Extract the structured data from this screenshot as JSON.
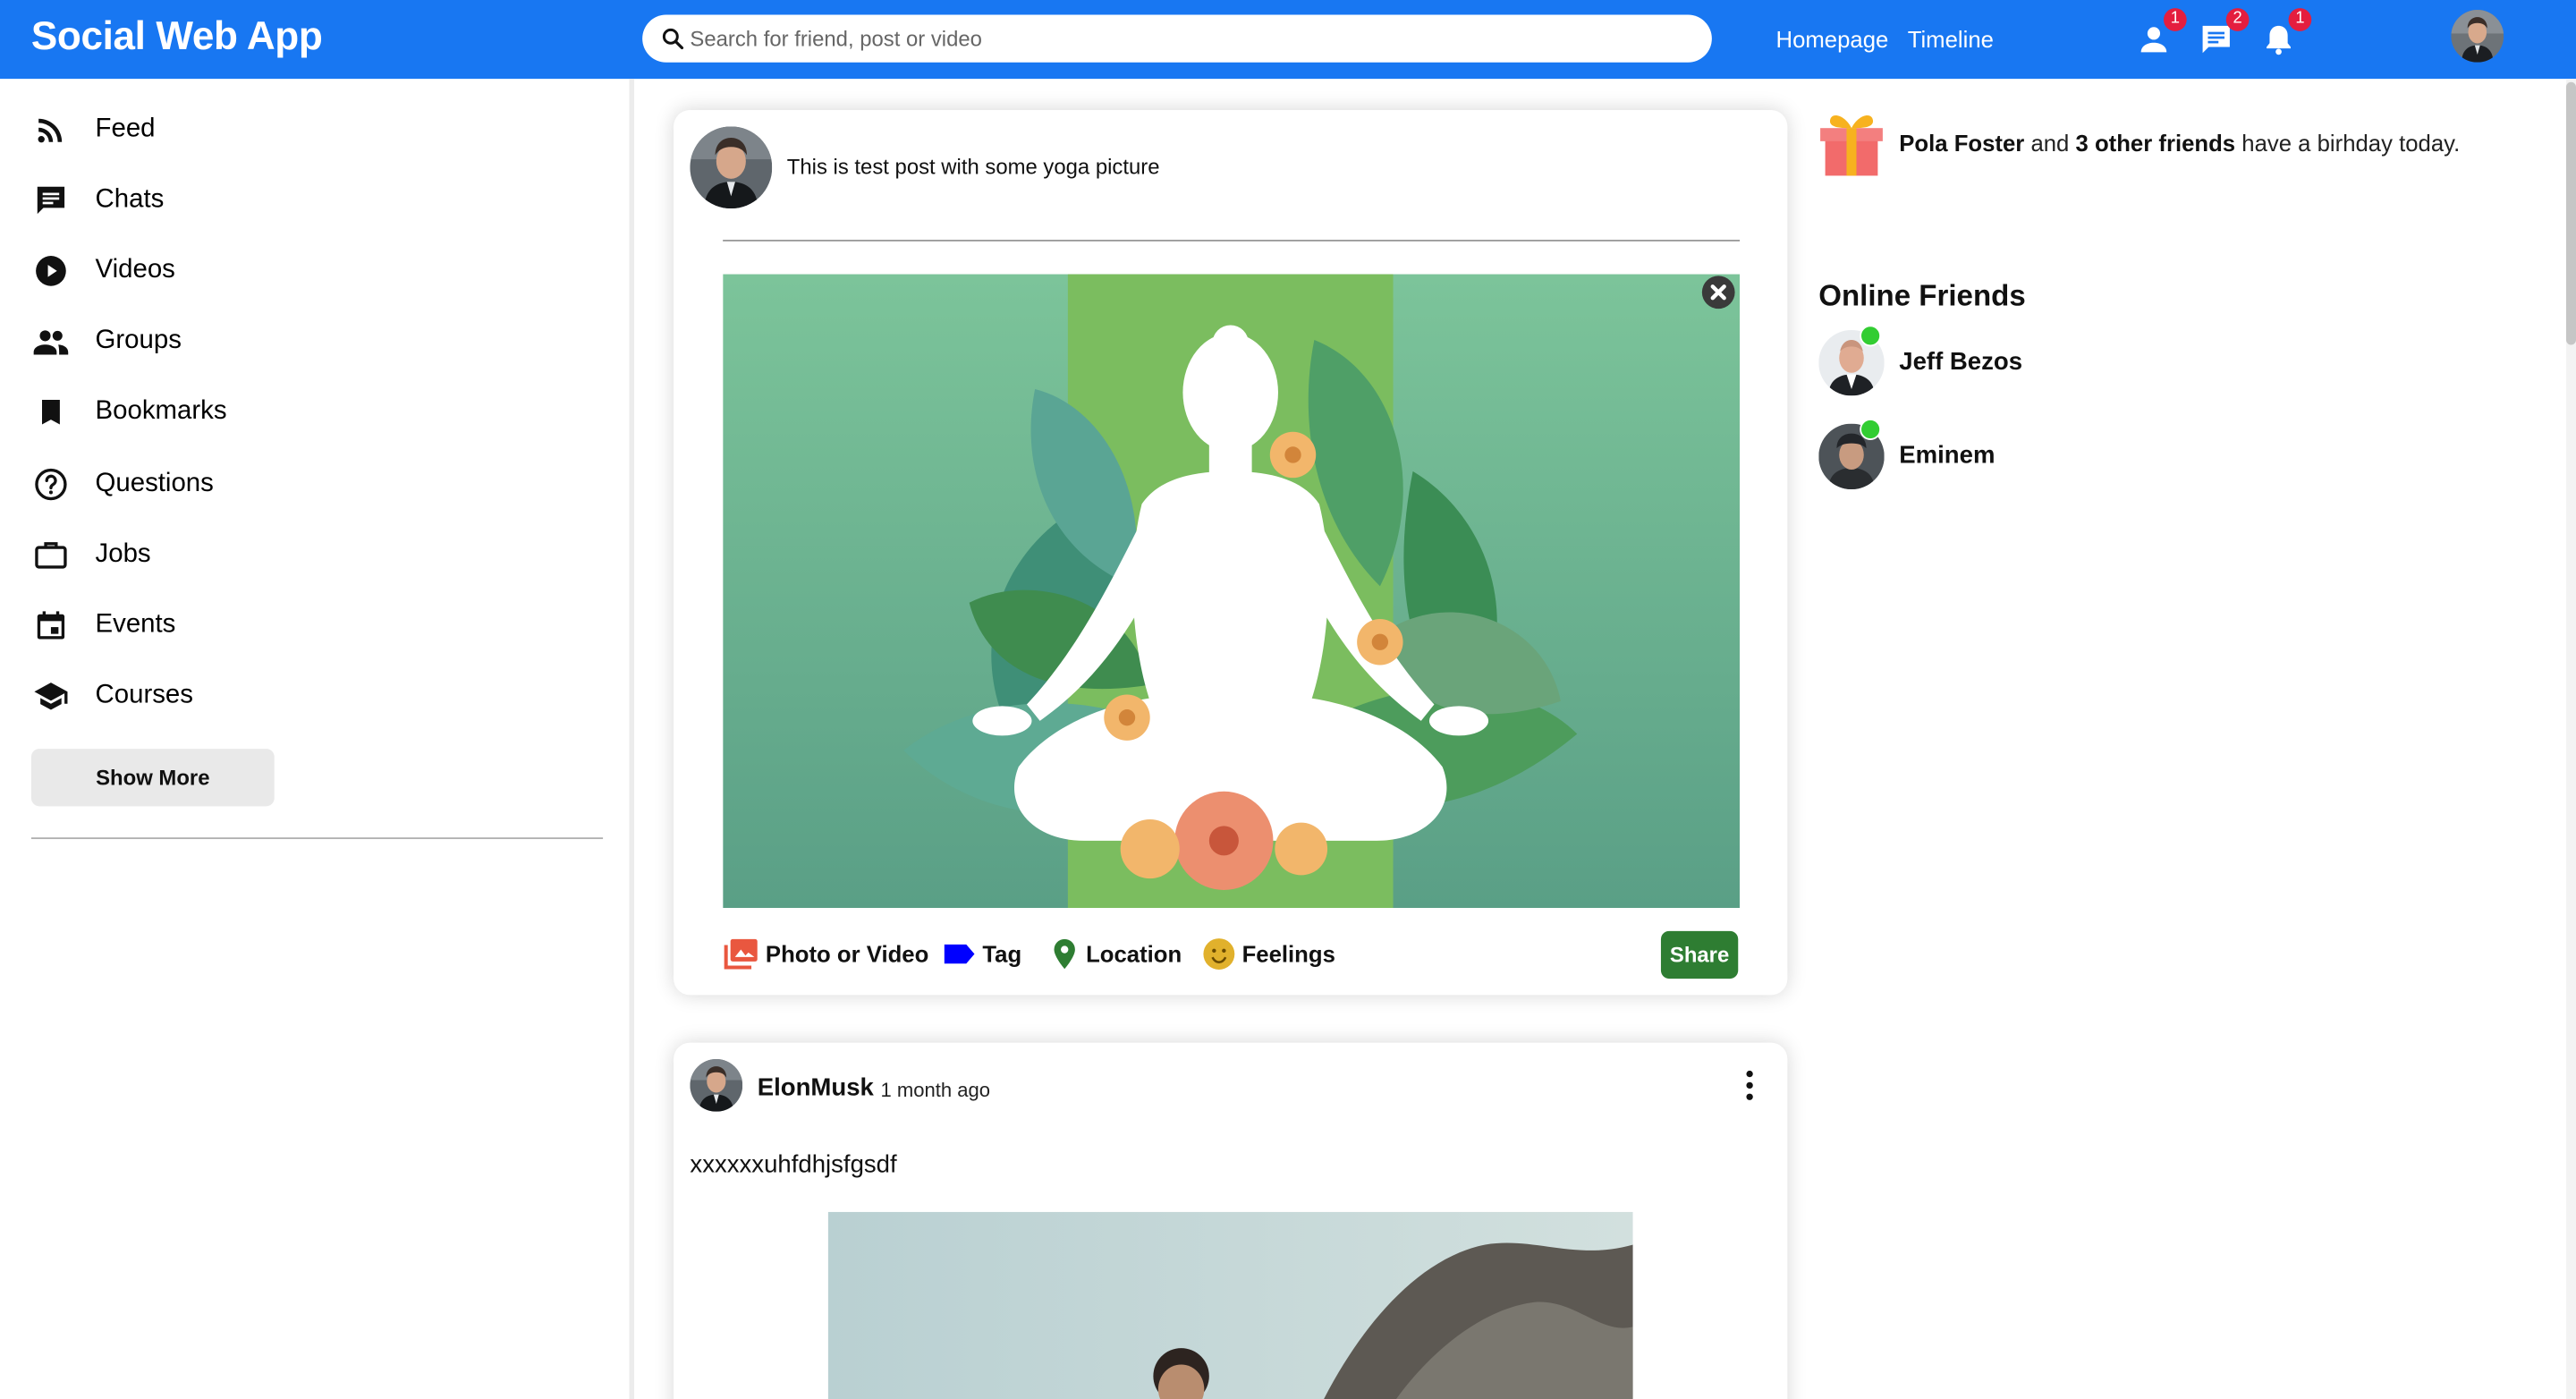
{
  "app": {
    "title": "Social Web App"
  },
  "search": {
    "placeholder": "Search for friend, post or video"
  },
  "nav": {
    "links": [
      "Homepage",
      "Timeline"
    ]
  },
  "notifications": {
    "friend_requests": "1",
    "messages": "2",
    "alerts": "1"
  },
  "sidebar": {
    "items": [
      {
        "label": "Feed",
        "icon": "rss-feed-icon"
      },
      {
        "label": "Chats",
        "icon": "chat-icon"
      },
      {
        "label": "Videos",
        "icon": "play-circle-icon"
      },
      {
        "label": "Groups",
        "icon": "group-icon"
      },
      {
        "label": "Bookmarks",
        "icon": "bookmark-icon"
      },
      {
        "label": "Questions",
        "icon": "help-circle-icon"
      },
      {
        "label": "Jobs",
        "icon": "briefcase-icon"
      },
      {
        "label": "Events",
        "icon": "calendar-icon"
      },
      {
        "label": "Courses",
        "icon": "school-icon"
      }
    ],
    "show_more": "Show More"
  },
  "share": {
    "text": "This is test post with some yoga picture",
    "options": [
      "Photo or Video",
      "Tag",
      "Location",
      "Feelings"
    ],
    "share_button": "Share",
    "option_colors": [
      "#e9573f",
      "#0000ff",
      "#2e7d32",
      "#e1b12c"
    ]
  },
  "post": {
    "username": "ElonMusk",
    "time": "1 month ago",
    "text": "xxxxxxuhfdhjsfgsdf"
  },
  "rightbar": {
    "birthday": {
      "name": "Pola Foster",
      "and": "and",
      "others": "3 other friends",
      "suffix": "have a birhday today."
    },
    "online_title": "Online Friends",
    "friends": [
      "Jeff Bezos",
      "Eminem"
    ]
  },
  "colors": {
    "topbar": "#1877f2",
    "badge": "#e41e3f",
    "share_button": "#2e7d32",
    "online": "#32cd32"
  }
}
